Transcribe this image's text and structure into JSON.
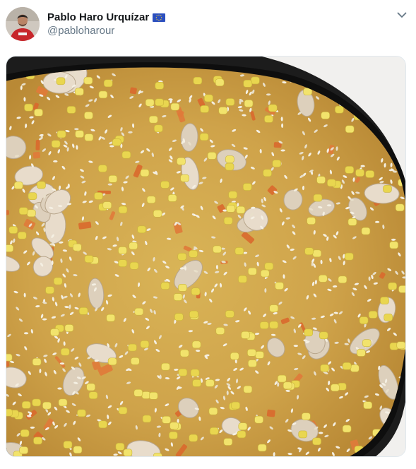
{
  "tweet": {
    "author": {
      "display_name": "Pablo Haro Urquízar",
      "handle": "@pabloharour",
      "badge_icon": "eu-flag-icon"
    },
    "menu_icon": "chevron-down-icon",
    "media": {
      "kind": "photo",
      "colors": {
        "broth": "#d1a64a",
        "corn": "#f2e36c",
        "pan": "#1c1c1c",
        "counter": "#f1f0ee"
      }
    }
  }
}
